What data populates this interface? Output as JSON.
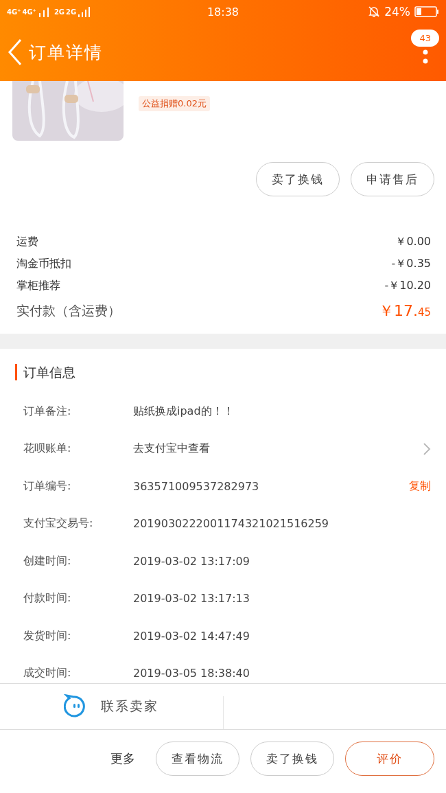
{
  "status_bar": {
    "network_1": "4G⁺",
    "network_2": "4G⁺",
    "network_3": "2G",
    "network_4": "2G",
    "time": "18:38",
    "battery": "24%"
  },
  "nav": {
    "title": "订单详情",
    "badge": "43"
  },
  "product": {
    "charity_tag": "公益捐赠0.02元"
  },
  "item_actions": [
    "卖了换钱",
    "申请售后"
  ],
  "fees": [
    {
      "label": "运费",
      "value": "￥0.00",
      "kind": "normal"
    },
    {
      "label": "淘金币抵扣",
      "value": "-￥0.35",
      "kind": "normal"
    },
    {
      "label": "掌柜推荐",
      "value": "-￥10.20",
      "kind": "normal"
    },
    {
      "label": "实付款（含运费）",
      "value": "￥17.",
      "value_small": "45",
      "kind": "total"
    }
  ],
  "order_info": {
    "title": "订单信息",
    "rows": [
      {
        "label": "订单备注:",
        "value": "贴纸换成ipad的！！",
        "kind": "text"
      },
      {
        "label": "花呗账单:",
        "value": "去支付宝中查看",
        "kind": "link"
      },
      {
        "label": "订单编号:",
        "value": "363571009537282973",
        "action": "复制",
        "kind": "copy"
      },
      {
        "label": "支付宝交易号:",
        "value": "2019030222001174321021516259",
        "kind": "text"
      },
      {
        "label": "创建时间:",
        "value": "2019-03-02 13:17:09",
        "kind": "text"
      },
      {
        "label": "付款时间:",
        "value": "2019-03-02 13:17:13",
        "kind": "text"
      },
      {
        "label": "发货时间:",
        "value": "2019-03-02 14:47:49",
        "kind": "text"
      },
      {
        "label": "成交时间:",
        "value": "2019-03-05 18:38:40",
        "kind": "text"
      }
    ]
  },
  "contact": {
    "label": "联系卖家"
  },
  "bottom_bar": {
    "more": "更多",
    "buttons": [
      {
        "label": "查看物流",
        "primary": false
      },
      {
        "label": "卖了换钱",
        "primary": false
      },
      {
        "label": "评价",
        "primary": true
      }
    ]
  }
}
